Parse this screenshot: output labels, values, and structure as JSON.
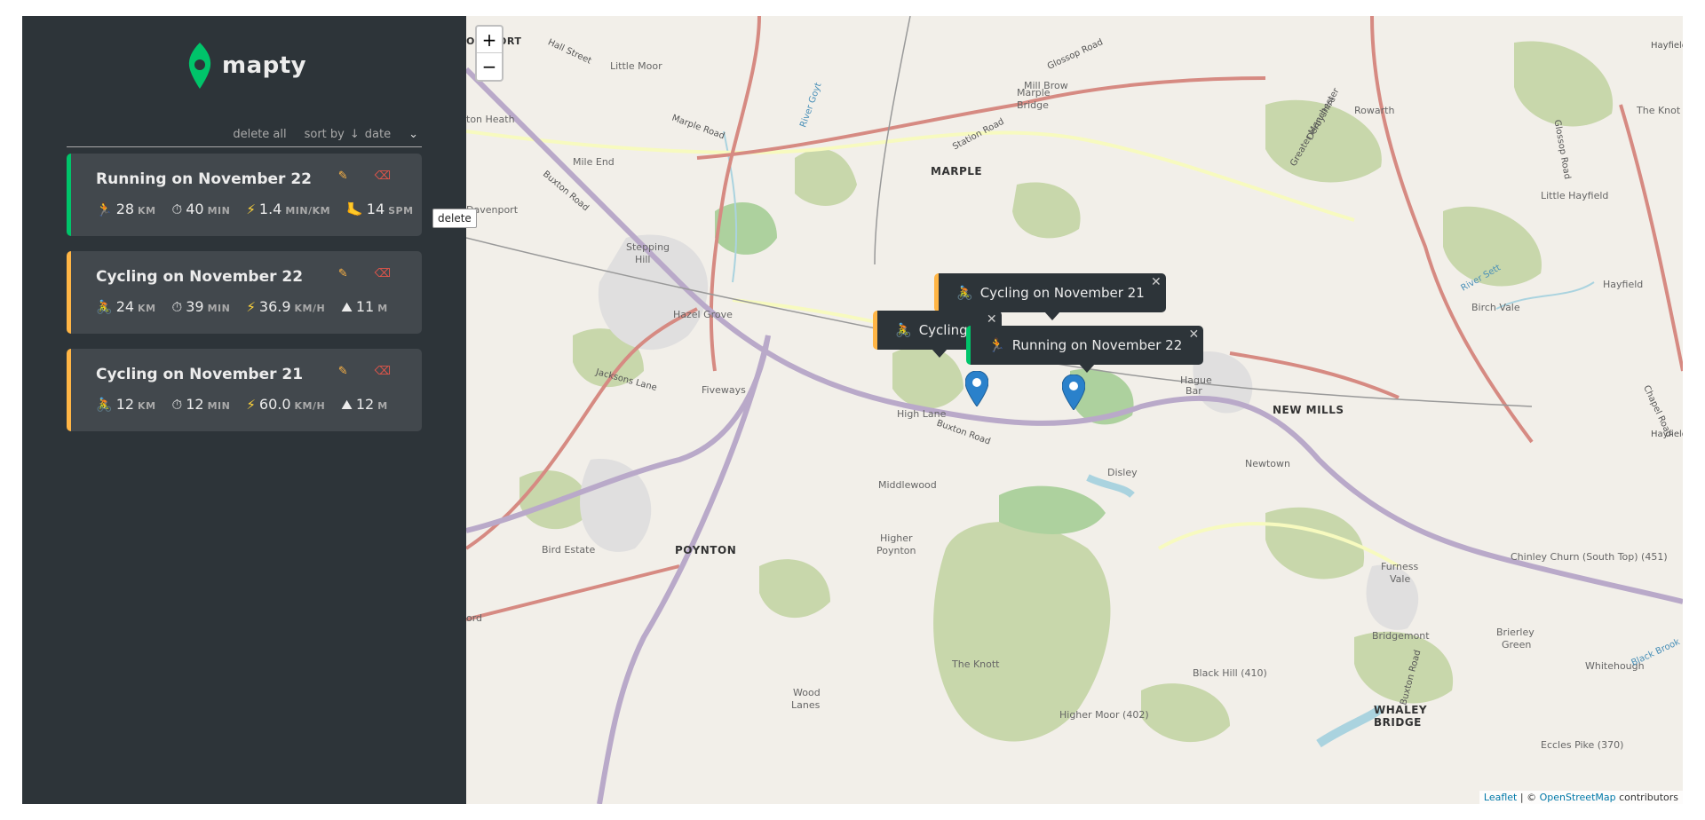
{
  "sidebar": {
    "logo_text": "mapty",
    "delete_all": "delete all",
    "sort_label": "sort by",
    "sort_arrow": "↓",
    "sort_value": "date",
    "tooltip": "delete"
  },
  "workouts": [
    {
      "type": "running",
      "title": "Running on November 22",
      "type_icon": "🏃",
      "distance": "28",
      "distance_unit": "km",
      "duration": "40",
      "duration_unit": "min",
      "speed": "1.4",
      "speed_unit": "min/km",
      "extra_icon": "🦶",
      "extra": "14",
      "extra_unit": "spm"
    },
    {
      "type": "cycling",
      "title": "Cycling on November 22",
      "type_icon": "🚴",
      "distance": "24",
      "distance_unit": "km",
      "duration": "39",
      "duration_unit": "min",
      "speed": "36.9",
      "speed_unit": "km/h",
      "extra_icon": "⛰",
      "extra": "11",
      "extra_unit": "m"
    },
    {
      "type": "cycling",
      "title": "Cycling on November 21",
      "type_icon": "🚴",
      "distance": "12",
      "distance_unit": "km",
      "duration": "12",
      "duration_unit": "min",
      "speed": "60.0",
      "speed_unit": "km/h",
      "extra_icon": "⛰",
      "extra": "12",
      "extra_unit": "m"
    }
  ],
  "map": {
    "zoom_in": "+",
    "zoom_out": "−",
    "popups": {
      "p1": "Cycling on November 21",
      "p2": "Cycling o",
      "p3": "Running on November 22"
    },
    "places": {
      "marple": "MARPLE",
      "new_mills": "NEW MILLS",
      "poynton": "POYNTON",
      "whaley": "WHALEY",
      "bridge": "BRIDGE",
      "hazel_grove": "Hazel Grove",
      "high_lane": "High Lane",
      "disley": "Disley",
      "middlewood": "Middlewood",
      "higher_poynton_1": "Higher",
      "higher_poynton_2": "Poynton",
      "mile_end": "Mile End",
      "davenport": "Davenport",
      "stepping_hill_1": "Stepping",
      "stepping_hill_2": "Hill",
      "fiveways": "Fiveways",
      "bird_estate": "Bird Estate",
      "the_knott": "The Knott",
      "wood_lanes_1": "Wood",
      "wood_lanes_2": "Lanes",
      "black_hill": "Black Hill (410)",
      "higher_moor": "Higher Moor (402)",
      "chinley_churn": "Chinley Churn (South Top) (451)",
      "eccles_pike": "Eccles Pike (370)",
      "furness_1": "Furness",
      "furness_2": "Vale",
      "bridgemont": "Bridgemont",
      "brierley_1": "Brierley",
      "brierley_2": "Green",
      "whitehough": "Whitehough",
      "newtown": "Newtown",
      "hague_1": "Hague",
      "hague_2": "Bar",
      "birch_vale": "Birch Vale",
      "new_mills_2": "New Mills",
      "hayfield": "Hayfield",
      "little_hayfield": "Little Hayfield",
      "rowarth": "Rowarth",
      "the_knot": "The Knot",
      "mill_brow": "Mill Brow",
      "marple_bridge_1": "Marple",
      "marple_bridge_2": "Bridge",
      "little_moor": "Little Moor",
      "heaton": "ton Heath",
      "ockport": "OCKPORT",
      "ord": "ord",
      "hall_street": "Hall Street",
      "marple_road": "Marple Road",
      "buxton_road_1": "Buxton Road",
      "buxton_road_2": "Buxton Road",
      "buxton_road_3": "Buxton Road",
      "station_road": "Station Road",
      "glossop_road": "Glossop Road",
      "glossop_road_2": "Glossop Road",
      "jacksons_lane": "Jacksons Lane",
      "river_goyt": "River Goyt",
      "river_sett": "River Sett",
      "black_brook": "Black Brook",
      "greater_manchester": "Greater Manchester",
      "derbyshire": "Derbyshire",
      "chapel_road": "Chapel Road",
      "hayfield_2": "Hayfield",
      "hayfield_3": "Hayfield"
    },
    "attribution": {
      "leaflet": "Leaflet",
      "sep": " | © ",
      "osm": "OpenStreetMap",
      "suffix": " contributors"
    },
    "colors": {
      "land": "#f2efe9",
      "park": "#c8d7ab",
      "wood": "#add19e",
      "motorway_trunk": "#b9a9c9",
      "primary": "#d68a82",
      "secondary": "#f7fabf",
      "water": "#aad3df",
      "marker": "#2a81cb"
    }
  }
}
